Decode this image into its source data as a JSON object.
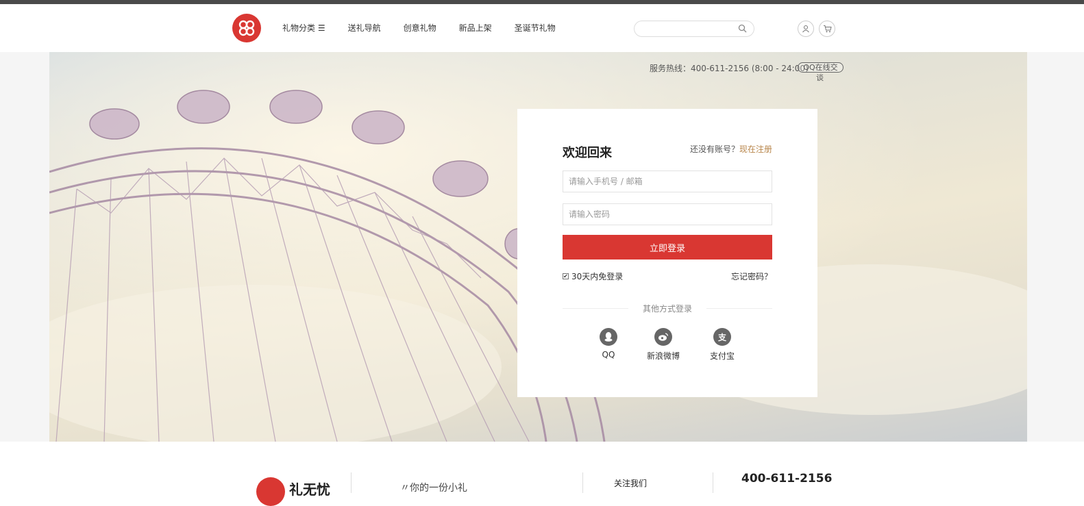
{
  "header": {
    "nav": [
      "礼物分类 ☰",
      "送礼导航",
      "创意礼物",
      "新品上架",
      "圣诞节礼物"
    ],
    "search_placeholder": ""
  },
  "hero": {
    "hotline": "服务热线：400-611-2156 (8:00 - 24:00)",
    "qq_chat": "QQ在线交",
    "qq_chat_tail": "谈"
  },
  "login": {
    "title": "欢迎回来",
    "no_account": "还没有账号？",
    "register": "现在注册",
    "account_placeholder": "请输入手机号 / 邮箱",
    "password_placeholder": "请输入密码",
    "submit": "立即登录",
    "remember": "30天内免登录",
    "forgot": "忘记密码？",
    "other_title": "其他方式登录",
    "social": [
      {
        "label": "QQ",
        "icon": "qq-icon"
      },
      {
        "label": "新浪微博",
        "icon": "weibo-icon"
      },
      {
        "label": "支付宝",
        "icon": "alipay-icon",
        "glyph": "支"
      }
    ]
  },
  "footer": {
    "brand": "礼无忧",
    "slogan": "〃你的一份小礼",
    "follow": "关注我们",
    "phone": "400-611-2156"
  },
  "colors": {
    "brand_red": "#d93732",
    "link_gold": "#b8864b"
  }
}
